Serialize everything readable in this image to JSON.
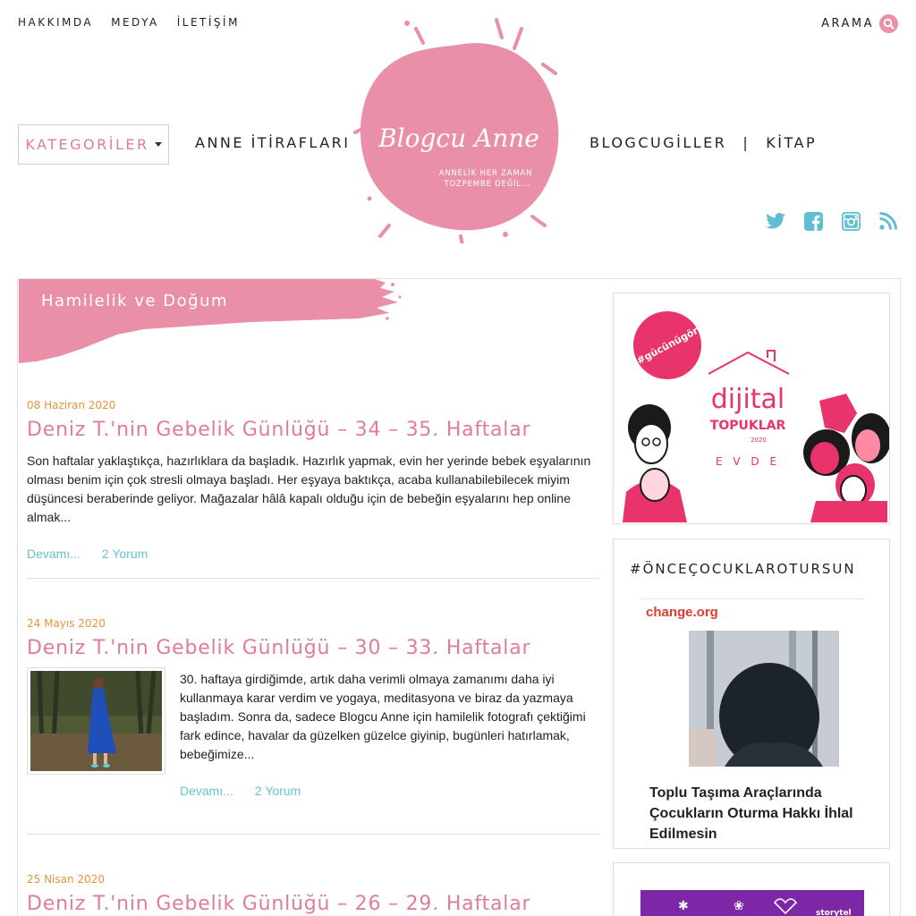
{
  "topnav": {
    "items": [
      "HAKKIMDA",
      "MEDYA",
      "İLETİŞİM"
    ],
    "search_label": "ARAMA"
  },
  "nav": {
    "categories_label": "KATEGORİLER",
    "anne_itiraflari": "ANNE İTİRAFLARI",
    "blogcugiller": "BLOGCUGİLLER",
    "separator": "|",
    "kitap": "KİTAP"
  },
  "logo": {
    "script_text": "Blogcu Anne",
    "tagline_1": "ANNELİK HER ZAMAN",
    "tagline_2": "TOZPEMBE DEĞİL..."
  },
  "social_icons": [
    "twitter-icon",
    "facebook-icon",
    "instagram-icon",
    "rss-icon"
  ],
  "category_title": "Hamilelik ve Doğum",
  "posts": [
    {
      "date": "08 Haziran 2020",
      "title": "Deniz T.'nin Gebelik Günlüğü – 34 – 35. Haftalar",
      "excerpt": "Son haftalar yaklaştıkça, hazırlıklara da başladık. Hazırlık yapmak, evin her yerinde bebek eşyalarının olması benim için çok stresli olmaya başladı. Her eşyaya baktıkça, acaba kullanabilebilecek miyim düşüncesi beraberinde geliyor. Mağazalar hâlâ kapalı olduğu için de bebeğin eşyalarını hep online almak...",
      "more": "Devamı...",
      "comments": "2 Yorum"
    },
    {
      "date": "24 Mayıs 2020",
      "title": "Deniz T.'nin Gebelik Günlüğü – 30 – 33. Haftalar",
      "excerpt": "30. haftaya girdiğimde, artık daha verimli olmaya zamanımı daha iyi kullanmaya karar verdim ve yogaya, meditasyona ve biraz da yazmaya başladım. Sonra da, sadece Blogcu Anne için hamilelik fotografı çektiğimi fark edince, havalar da güzelken güzelce giyinip, bugünleri hatırlamak, bebeğimize...",
      "more": "Devamı...",
      "comments": "2 Yorum"
    },
    {
      "date": "25 Nisan 2020",
      "title": "Deniz T.'nin Gebelik Günlüğü – 26 – 29. Haftalar"
    }
  ],
  "sidebar": {
    "ad1": {
      "hashtag": "#gücünügör",
      "brand": "dijital",
      "brand2": "TOPUKLAR",
      "year": "2020",
      "evde": "E V D E"
    },
    "ad2": {
      "hashtag": "#ÖNCEÇOCUKLAROTURSUN",
      "source": "change.org",
      "petition_title": "Toplu Taşıma Araçlarında Çocukların Oturma Hakkı İhlal Edilmesin"
    },
    "ad3": {
      "brand": "storytel"
    }
  },
  "colors": {
    "pink": "#e98fa8",
    "title_pink": "#e07b9c",
    "date_orange": "#e7943b",
    "link_teal": "#69c2d0",
    "social_teal": "#5fbfd0"
  }
}
